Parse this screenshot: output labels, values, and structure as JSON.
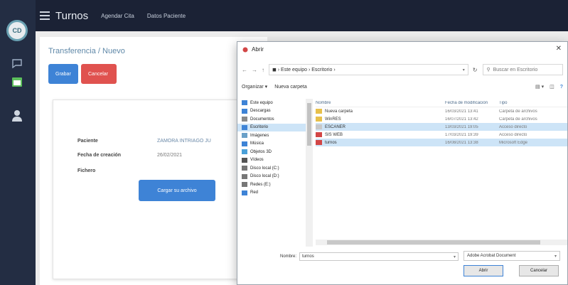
{
  "rail": {
    "logo_text": "CD"
  },
  "topbar": {
    "brand": "Turnos",
    "nav": [
      "Agendar Cita",
      "Datos Paciente"
    ]
  },
  "page": {
    "breadcrumb": "Transferencia / Nuevo",
    "save_label": "Grabar",
    "cancel_label": "Cancelar",
    "fields": {
      "patient_label": "Paciente",
      "patient_value": "ZAMORA INTRIAGO JU",
      "created_label": "Fecha de creación",
      "created_value": "26/02/2021",
      "files_label": "Fichero",
      "upload_label": "Cargar su archivo"
    }
  },
  "dialog": {
    "title": "Abrir",
    "close": "✕",
    "address": "◼ › Este equipo › Escritorio ›",
    "search_placeholder": "Buscar en Escritorio",
    "organize": "Organizar ▾",
    "new_folder": "Nueva carpeta",
    "tree": [
      {
        "label": "Este equipo",
        "color": "#3e83d6"
      },
      {
        "label": "Descargas",
        "color": "#3e83d6"
      },
      {
        "label": "Documentos",
        "color": "#8a8a8a"
      },
      {
        "label": "Escritorio",
        "color": "#3e83d6",
        "selected": true
      },
      {
        "label": "Imágenes",
        "color": "#6aa0c8"
      },
      {
        "label": "Música",
        "color": "#3e83d6"
      },
      {
        "label": "Objetos 3D",
        "color": "#4aa0d8"
      },
      {
        "label": "Vídeos",
        "color": "#555"
      },
      {
        "label": "Disco local (C:)",
        "color": "#777"
      },
      {
        "label": "Disco local (D:)",
        "color": "#777"
      },
      {
        "label": "Redes (E:)",
        "color": "#777"
      },
      {
        "label": "Red",
        "color": "#3e83d6"
      }
    ],
    "columns": [
      "Nombre",
      "Fecha de modificación",
      "Tipo"
    ],
    "files": [
      {
        "name": "Nueva carpeta",
        "date": "16/03/2021 13:41",
        "type": "Carpeta de archivos",
        "icon": "#e7c04b"
      },
      {
        "name": "WinRES",
        "date": "16/07/2021 13:42",
        "type": "Carpeta de archivos",
        "icon": "#e7c04b"
      },
      {
        "name": "ESCANER",
        "date": "13/03/2021 19:05",
        "type": "Acceso directo",
        "icon": "#c8c8c8",
        "selected": true
      },
      {
        "name": "SIS WEB",
        "date": "17/03/2021 19:39",
        "type": "Acceso directo",
        "icon": "#d24646"
      },
      {
        "name": "turnos",
        "date": "16/08/2021 13:38",
        "type": "Microsoft Edge",
        "icon": "#d24646",
        "selected": true
      }
    ],
    "filename_label": "Nombre:",
    "filename_value": "turnos",
    "filetype": "Adobe Acrobat Document",
    "open_label": "Abrir",
    "cancel_label": "Cancelar"
  }
}
